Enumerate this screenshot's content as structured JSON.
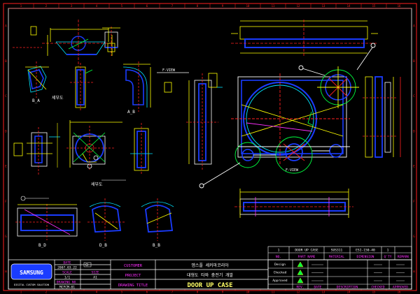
{
  "colors": {
    "background": "#000000",
    "border": "#ff2020",
    "outline": "#ffffff",
    "blue": "#1a3cff",
    "yellow": "#ffff00",
    "cyan": "#00e5ff",
    "green": "#00ff40",
    "magenta": "#ff30ff",
    "title_yellow": "#ffff66",
    "pink": "#ff4080"
  },
  "column_labels": [
    "1",
    "2",
    "3",
    "4",
    "5",
    "6",
    "7",
    "8",
    "9",
    "10",
    "11",
    "12",
    "13",
    "14",
    "15",
    "16"
  ],
  "row_labels": [
    "A",
    "B",
    "C",
    "D",
    "E",
    "F",
    "G",
    "H"
  ],
  "views": {
    "b_a": "B_A",
    "a_b": "A_B",
    "b_d": "B_D",
    "d_b": "D_B",
    "b_b": "B_B",
    "front_left": "F-VIEW",
    "front_right": "F-VIEW",
    "detail": "세부도"
  },
  "logo": {
    "text_top": "SAMSUNG",
    "text_bottom": "DIGITAL CUSTOM SOLUTION"
  },
  "title_block": {
    "date_label": "DATE",
    "date_value": "2007.03.22",
    "scale_label": "SCALE",
    "scale_value": "1/1",
    "drawing_no_label": "DRAWING NO.",
    "drawing_no_value": "MCFCM-01",
    "size_label": "SIZE",
    "size_value": "A1",
    "customer_label": "CUSTOMER",
    "customer_value": "엠스플 세커마코리아",
    "project_label": "PROJECT",
    "project_value": "대형도 타와 충전기 개발",
    "drawing_title_label": "DRAWING TITLE",
    "drawing_title_value": "DOOR UP CASE"
  },
  "parts_table": {
    "row": {
      "no": "1",
      "part_name": "DOOR UP CASE",
      "material": "SUS311",
      "dimension": "ESI-150-40",
      "qty": "1",
      "remark": ""
    },
    "headers": {
      "no": "NO.",
      "part_name": "PART NAME",
      "material": "MATERIAL",
      "dimension": "DIMENSION",
      "qty": "Q'TY",
      "remark": "REMARK"
    }
  },
  "revision_table": {
    "rows": [
      "Design",
      "Checked",
      "Approved"
    ],
    "headers": {
      "rev": "REV.",
      "date": "DATE",
      "description": "DESCRIPTION",
      "checked": "CHECKED",
      "approved": "APPROVED"
    }
  }
}
